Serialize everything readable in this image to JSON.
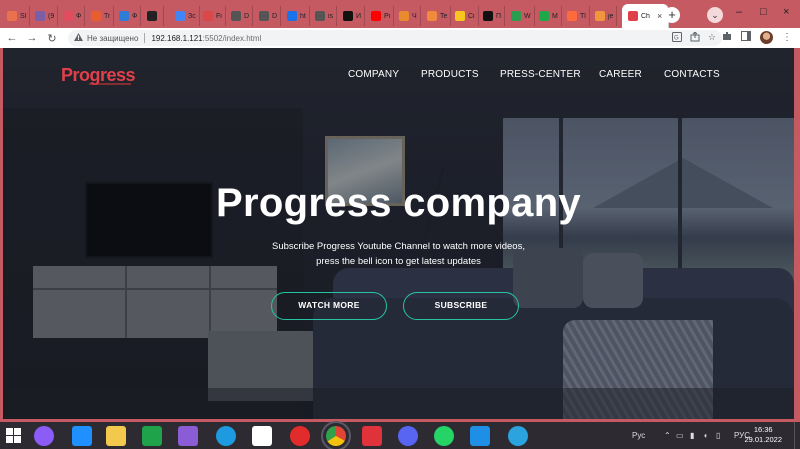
{
  "browser": {
    "tabs": [
      {
        "label": "Sl",
        "color": "#e8734a"
      },
      {
        "label": "(9",
        "color": "#7b5ea7"
      },
      {
        "label": "Ф",
        "color": "#e04d5f"
      },
      {
        "label": "Tr",
        "color": "#e85d2f"
      },
      {
        "label": "Ф",
        "color": "#2e7cd6"
      },
      {
        "label": "",
        "color": "#222222"
      },
      {
        "label": "Зс",
        "color": "#4285f4"
      },
      {
        "label": "Fi",
        "color": "#d94848"
      },
      {
        "label": "D",
        "color": "#555555"
      },
      {
        "label": "D",
        "color": "#555555"
      },
      {
        "label": "ht",
        "color": "#1a73e8"
      },
      {
        "label": "is",
        "color": "#555555"
      },
      {
        "label": "И",
        "color": "#111111"
      },
      {
        "label": "Pi",
        "color": "#ff0000"
      },
      {
        "label": "Ч",
        "color": "#e88a2e"
      },
      {
        "label": "Te",
        "color": "#f08a3c"
      },
      {
        "label": "Сi",
        "color": "#f7c51f"
      },
      {
        "label": "П",
        "color": "#111111"
      },
      {
        "label": "W",
        "color": "#2a9d4e"
      },
      {
        "label": "М",
        "color": "#1ea84a"
      },
      {
        "label": "Tl",
        "color": "#ff6a3d"
      },
      {
        "label": "je",
        "color": "#f3953a"
      }
    ],
    "active_tab": {
      "label": "Ch",
      "icon": "progress-favicon-icon"
    },
    "close_glyph": "×",
    "new_tab_glyph": "+",
    "tab_menu_glyph": "⌄",
    "window_controls": [
      "–",
      "□",
      "×"
    ],
    "nav": {
      "back": "←",
      "forward": "→",
      "reload": "↻"
    },
    "address": {
      "security_icon": "warning-triangle-icon",
      "security_text": "Не защищено",
      "host": "192.168.1.121",
      "path": ":5502/index.html"
    },
    "omni_icons": [
      "translate-icon",
      "share-icon",
      "bookmark-star-icon"
    ],
    "toolbar_icons": [
      "extensions-icon",
      "sidepanel-icon",
      "avatar-icon",
      "menu-dots-icon"
    ]
  },
  "site": {
    "logo": "Progress",
    "nav": [
      "COMPANY",
      "PRODUCTS",
      "PRESS-CENTER",
      "CAREER",
      "CONTACTS"
    ],
    "hero": {
      "title": "Progress company",
      "subtitle_line1": "Subscribe Progress Youtube Channel to watch more videos,",
      "subtitle_line2": "press the bell icon to get latest updates",
      "buttons": [
        "WATCH MORE",
        "SUBSCRIBE"
      ]
    },
    "colors": {
      "brand": "#e0404a",
      "accent": "#27c3a3"
    }
  },
  "taskbar": {
    "apps": [
      {
        "name": "alice-icon",
        "color": "#8b5cf6"
      },
      {
        "name": "ie-icon",
        "color": "#1e90ff"
      },
      {
        "name": "explorer-icon",
        "color": "#f2c94c"
      },
      {
        "name": "store-icon",
        "color": "#1fa34a"
      },
      {
        "name": "visual-studio-icon",
        "color": "#8a5cd6"
      },
      {
        "name": "edge-icon",
        "color": "#1e9be0"
      },
      {
        "name": "file-icon",
        "color": "#ffffff"
      },
      {
        "name": "opera-icon",
        "color": "#e22b2b"
      },
      {
        "name": "chrome-icon",
        "color": "#e8b83a"
      },
      {
        "name": "wps-icon",
        "color": "#e0323a"
      },
      {
        "name": "discord-icon",
        "color": "#5865f2"
      },
      {
        "name": "whatsapp-icon",
        "color": "#25d366"
      },
      {
        "name": "vscode-icon",
        "color": "#1f8fe6"
      },
      {
        "name": "telegram-icon",
        "color": "#2aa3df"
      }
    ],
    "tray": {
      "weather": "Рус",
      "lang": "РУС"
    },
    "time": "16:36",
    "date": "29.01.2022"
  }
}
